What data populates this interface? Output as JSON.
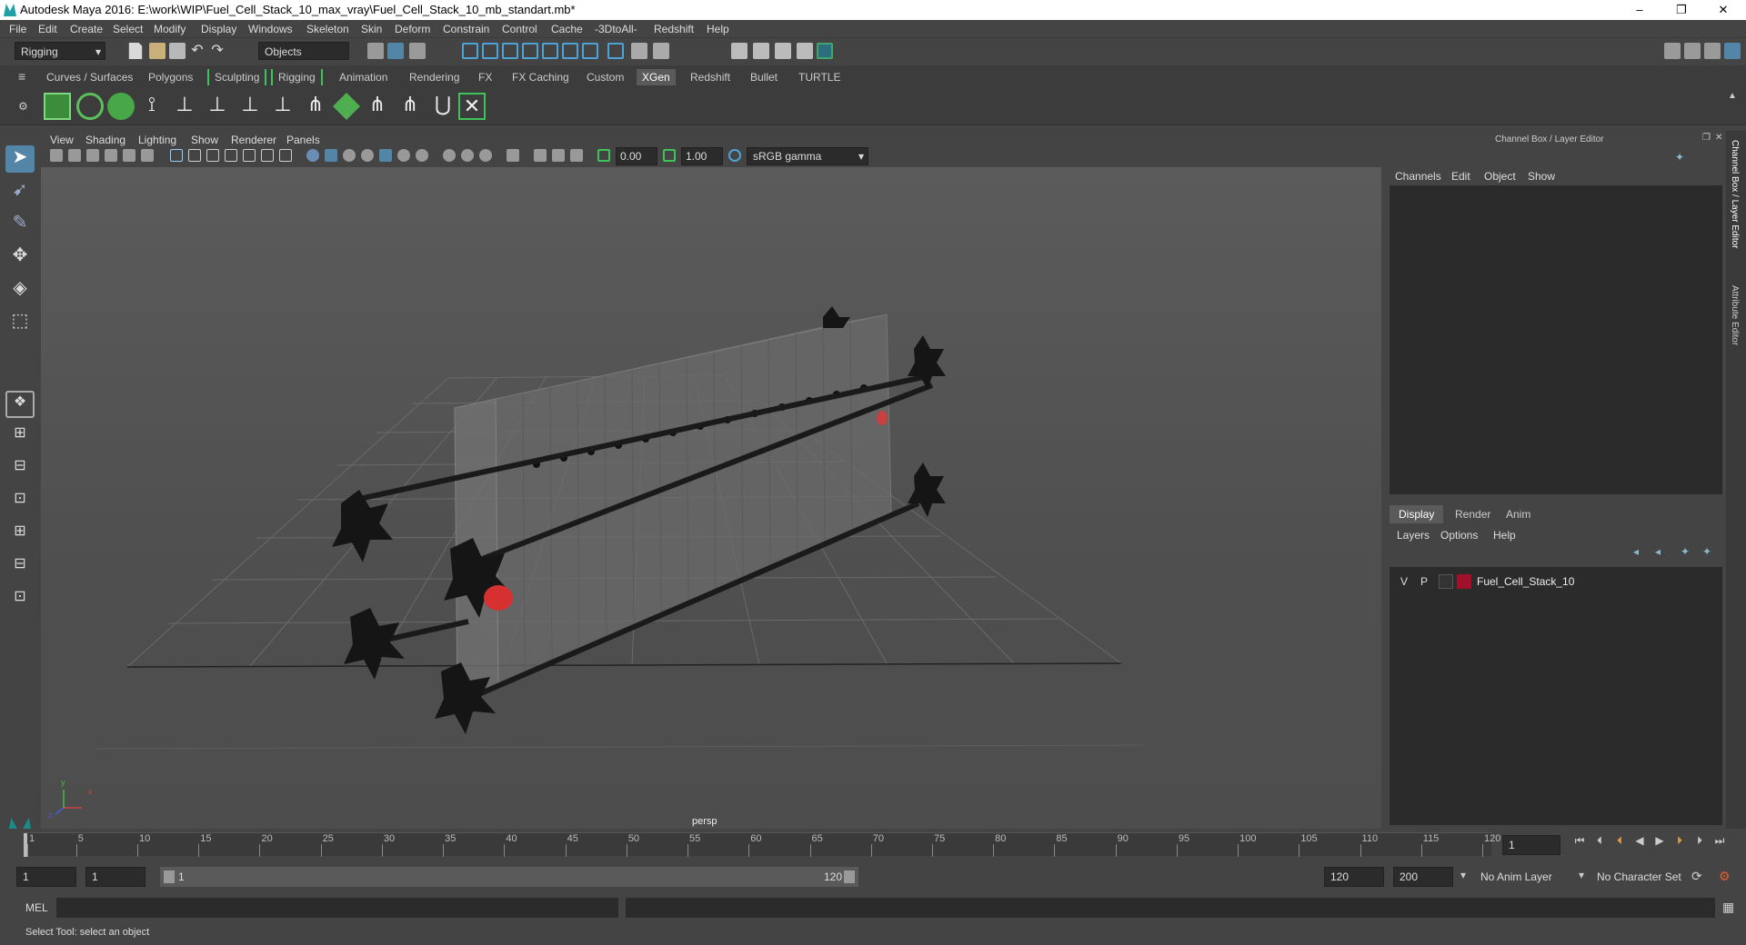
{
  "window": {
    "title": "Autodesk Maya 2016: E:\\work\\WIP\\Fuel_Cell_Stack_10_max_vray\\Fuel_Cell_Stack_10_mb_standart.mb*",
    "min": "–",
    "max": "❐",
    "close": "✕"
  },
  "menubar": [
    "File",
    "Edit",
    "Create",
    "Select",
    "Modify",
    "Display",
    "Windows",
    "Skeleton",
    "Skin",
    "Deform",
    "Constrain",
    "Control",
    "Cache",
    "-3DtoAll-",
    "Redshift",
    "Help"
  ],
  "statusline": {
    "mode": "Rigging",
    "select_mode": "Objects"
  },
  "shelf_tabs": [
    "Curves / Surfaces",
    "Polygons",
    "Sculpting",
    "Rigging",
    "Animation",
    "Rendering",
    "FX",
    "FX Caching",
    "Custom",
    "XGen",
    "Redshift",
    "Bullet",
    "TURTLE"
  ],
  "active_shelf_tab": "XGen",
  "viewport_menu": [
    "View",
    "Shading",
    "Lighting",
    "Show",
    "Renderer",
    "Panels"
  ],
  "viewport_bar": {
    "exposure": "0.00",
    "gamma": "1.00",
    "color_space": "sRGB gamma"
  },
  "viewport": {
    "camera_label": "persp",
    "axis_y": "y",
    "axis_x": "x",
    "axis_z": "z"
  },
  "channel_box": {
    "header": "Channel Box / Layer Editor",
    "menu": [
      "Channels",
      "Edit",
      "Object",
      "Show"
    ]
  },
  "layer_editor": {
    "tabs": [
      "Display",
      "Render",
      "Anim"
    ],
    "active_tab": "Display",
    "menu": [
      "Layers",
      "Options",
      "Help"
    ],
    "layers": [
      {
        "v": "V",
        "p": "P",
        "name": "Fuel_Cell_Stack_10",
        "color": "#a0102a"
      }
    ]
  },
  "side_tabs": [
    "Channel Box / Layer Editor",
    "Attribute Editor"
  ],
  "timeslider": {
    "ticks": [
      "1",
      "5",
      "10",
      "15",
      "20",
      "25",
      "30",
      "35",
      "40",
      "45",
      "50",
      "55",
      "60",
      "65",
      "70",
      "75",
      "80",
      "85",
      "90",
      "95",
      "100",
      "105",
      "110",
      "115",
      "120"
    ],
    "current_frame": "1"
  },
  "range": {
    "start": "1",
    "inner_start": "1",
    "slider_start": "1",
    "slider_end": "120",
    "end": "120",
    "max": "200",
    "anim_layer": "No Anim Layer",
    "char_set": "No Character Set"
  },
  "cmd": {
    "label": "MEL"
  },
  "help": {
    "text": "Select Tool: select an object"
  },
  "colors": {
    "accent": "#5285a6",
    "layer": "#a0102a",
    "red_part": "#d63030"
  }
}
